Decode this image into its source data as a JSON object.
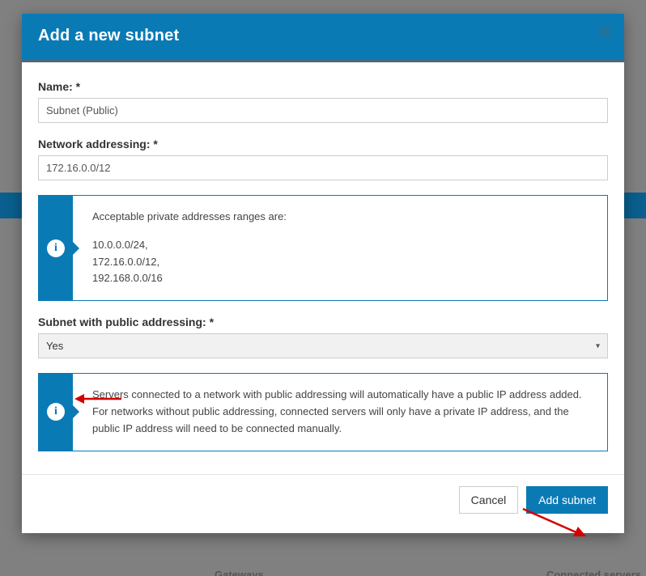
{
  "modal": {
    "title": "Add a new subnet",
    "fields": {
      "name_label": "Name: *",
      "name_value": "Subnet (Public)",
      "addressing_label": "Network addressing: *",
      "addressing_value": "172.16.0.0/12",
      "public_label": "Subnet with public addressing: *",
      "public_value": "Yes"
    },
    "callout1": {
      "intro": "Acceptable private addresses ranges are:",
      "l1": "10.0.0.0/24,",
      "l2": "172.16.0.0/12,",
      "l3": "192.168.0.0/16"
    },
    "callout2": {
      "text": "Servers connected to a network with public addressing will automatically have a public IP address added. For networks without public addressing, connected servers will only have a private IP address, and the public IP address will need to be connected manually."
    },
    "footer": {
      "cancel": "Cancel",
      "submit": "Add subnet"
    }
  },
  "background": {
    "gateways": "Gateways",
    "connected_servers": "Connected servers"
  }
}
